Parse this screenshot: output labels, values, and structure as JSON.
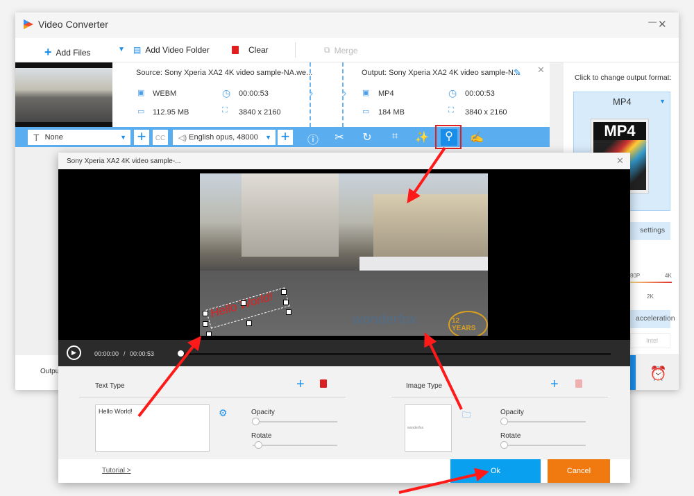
{
  "app": {
    "title": "Video Converter"
  },
  "toolbar": {
    "add_files": "Add Files",
    "add_folder": "Add Video Folder",
    "clear": "Clear",
    "merge": "Merge"
  },
  "source": {
    "name": "Source: Sony Xperia XA2 4K video sample-NA.we...",
    "format": "WEBM",
    "duration": "00:00:53",
    "size": "112.95 MB",
    "resolution": "3840 x 2160"
  },
  "output": {
    "name": "Output: Sony Xperia XA2 4K video sample-N...",
    "format": "MP4",
    "duration": "00:00:53",
    "size": "184 MB",
    "resolution": "3840 x 2160"
  },
  "editbar": {
    "subtitle": "None",
    "audio": "English opus, 48000",
    "cc": "CC"
  },
  "right_panel": {
    "change_label": "Click to change output format:",
    "format": "MP4",
    "format_icon_text": "MP4",
    "settings": "settings",
    "quality_labels": [
      "80P",
      "4K",
      "2K"
    ],
    "acceleration": "acceleration",
    "intel": "Intel"
  },
  "left_bottom": {
    "output_label": "Outpu"
  },
  "dialog": {
    "title": "Sony Xperia XA2 4K video sample-...",
    "watermark_text": "Hello World!",
    "logo_text": "wonderfox",
    "years_badge": "12 YEARS",
    "time_current": "00:00:00",
    "time_sep": "/",
    "time_total": "00:00:53",
    "progress_fraction": 0,
    "text_type": "Text Type",
    "image_type": "Image Type",
    "text_value": "Hello World!",
    "opacity": "Opacity",
    "rotate": "Rotate",
    "text_opacity_fraction": 0,
    "text_rotate_fraction": 0.05,
    "image_opacity_fraction": 0,
    "image_rotate_fraction": 0,
    "tutorial": "Tutorial >",
    "ok": "Ok",
    "cancel": "Cancel"
  },
  "colors": {
    "accent": "#1a8de9",
    "bar": "#5aaef0",
    "ok": "#0aa0f0",
    "cancel": "#f07a10",
    "annotation": "#ff1a1a"
  }
}
